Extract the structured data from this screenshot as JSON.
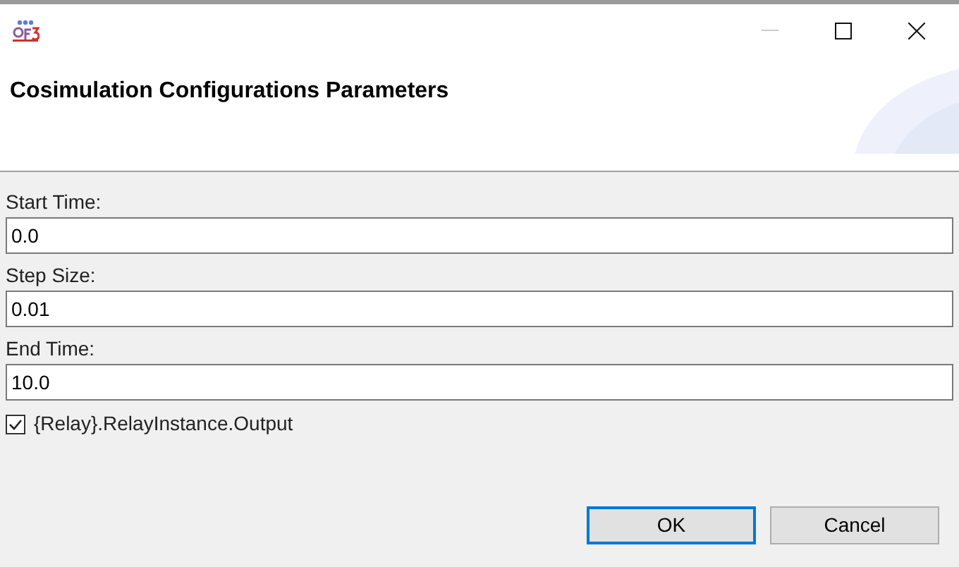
{
  "window": {
    "controls": [
      {
        "kind": "minimize",
        "disabled": true
      },
      {
        "kind": "maximize",
        "disabled": false
      },
      {
        "kind": "close",
        "disabled": false
      }
    ]
  },
  "header": {
    "title": "Cosimulation Configurations Parameters"
  },
  "fields": [
    {
      "label": "Start Time:",
      "value": "0.0"
    },
    {
      "label": "Step Size:",
      "value": "0.01"
    },
    {
      "label": "End Time:",
      "value": "10.0"
    }
  ],
  "checkbox": {
    "label": "{Relay}.RelayInstance.Output",
    "checked": true
  },
  "buttons": [
    {
      "label": "OK",
      "default": true
    },
    {
      "label": "Cancel",
      "default": false
    }
  ]
}
